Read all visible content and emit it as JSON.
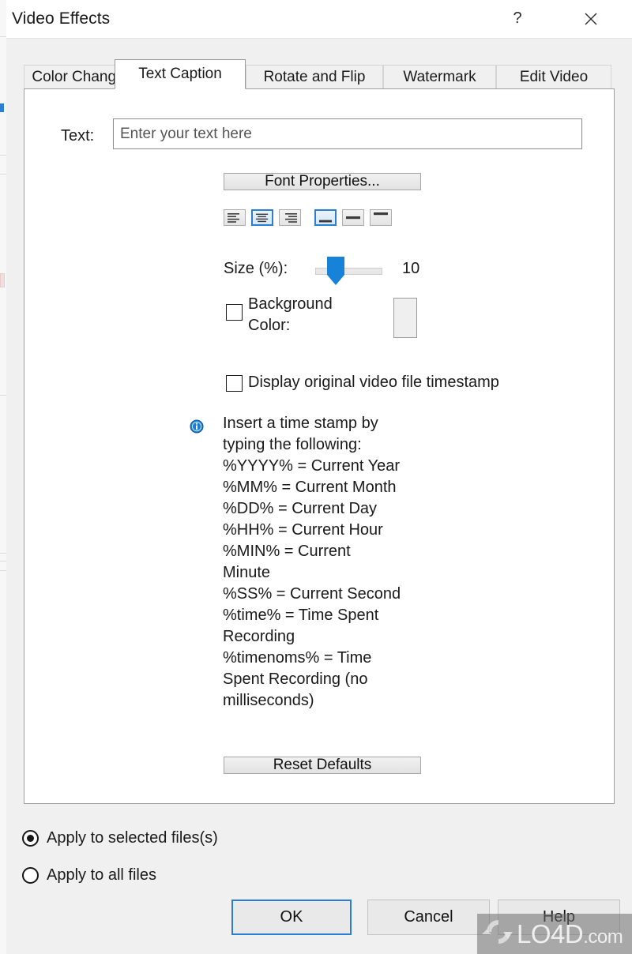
{
  "window": {
    "title": "Video Effects",
    "help_glyph": "?",
    "close_glyph": "✕"
  },
  "tabs": [
    {
      "id": "color-change",
      "label": "Color Change",
      "selected": false
    },
    {
      "id": "text-caption",
      "label": "Text Caption",
      "selected": true
    },
    {
      "id": "rotate-flip",
      "label": "Rotate and Flip",
      "selected": false
    },
    {
      "id": "watermark",
      "label": "Watermark",
      "selected": false
    },
    {
      "id": "edit-video",
      "label": "Edit Video",
      "selected": false
    }
  ],
  "text_caption": {
    "text_label": "Text:",
    "text_value": "",
    "text_placeholder": "Enter your text here",
    "font_properties_label": "Font Properties...",
    "alignment": {
      "horizontal": [
        {
          "name": "align-left",
          "label": "Align Left",
          "selected": false
        },
        {
          "name": "align-center",
          "label": "Align Center",
          "selected": true
        },
        {
          "name": "align-right",
          "label": "Align Right",
          "selected": false
        }
      ],
      "vertical": [
        {
          "name": "valign-bottom",
          "label": "Align Bottom",
          "selected": true
        },
        {
          "name": "valign-middle",
          "label": "Align Middle",
          "selected": false
        },
        {
          "name": "valign-top",
          "label": "Align Top",
          "selected": false
        }
      ]
    },
    "size_label": "Size (%):",
    "size_value": "10",
    "size_min": 0,
    "size_max": 100,
    "background_color_label": "Background\nColor:",
    "background_color_checked": false,
    "background_color_swatch": "#efefef",
    "timestamp_label": "Display original video file timestamp",
    "timestamp_checked": false,
    "info_text": "Insert a time stamp by\ntyping the following:\n%YYYY% = Current Year\n%MM% = Current Month\n%DD% = Current Day\n%HH% = Current Hour\n%MIN% = Current\nMinute\n%SS% = Current Second\n%time% = Time Spent\nRecording\n%timenoms% = Time\nSpent Recording (no\nmilliseconds)",
    "reset_defaults_label": "Reset Defaults"
  },
  "apply_options": [
    {
      "id": "selected-files",
      "label": "Apply to selected files(s)",
      "selected": true
    },
    {
      "id": "all-files",
      "label": "Apply to all files",
      "selected": false
    }
  ],
  "buttons": {
    "ok": "OK",
    "cancel": "Cancel",
    "help": "Help"
  },
  "watermark": {
    "name": "LO4D",
    "suffix": ".com"
  },
  "colors": {
    "accent": "#2a7fd4",
    "window_bg": "#f0f0f0",
    "panel_bg": "#ffffff",
    "text": "#1a1a1a"
  }
}
